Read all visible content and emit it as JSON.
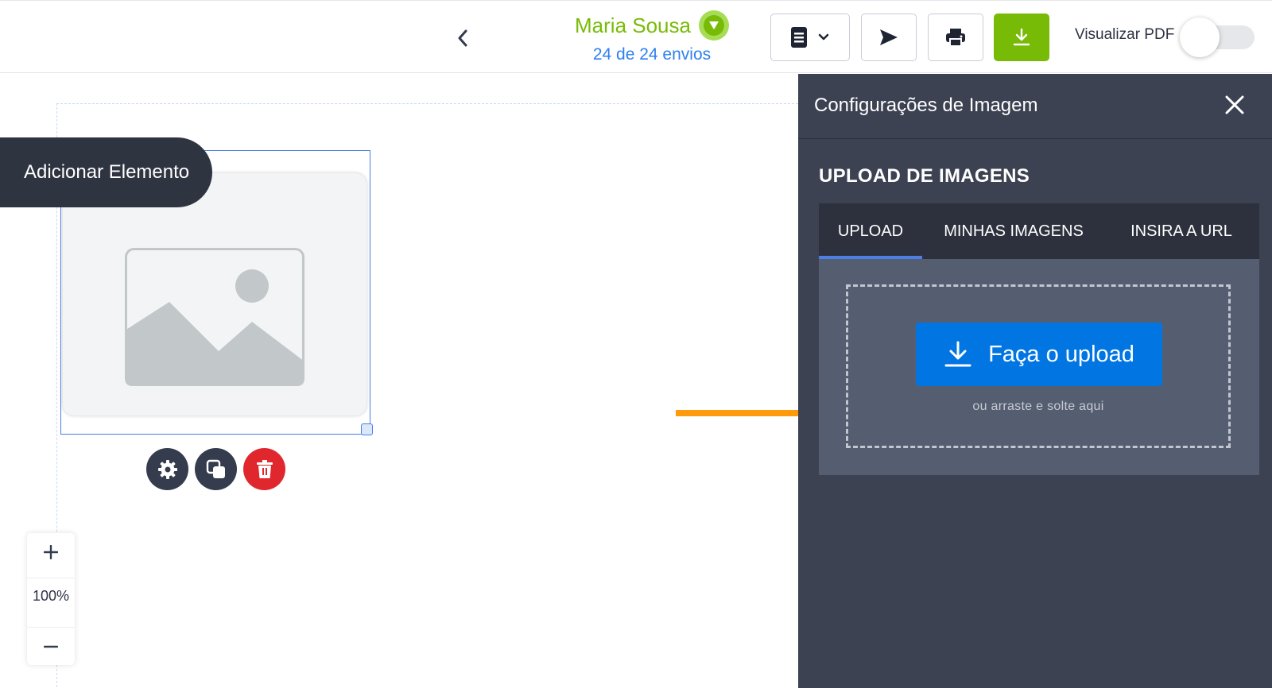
{
  "header": {
    "submitter_name": "Maria Sousa",
    "submission_count": "24 de 24 envios",
    "preview_pdf_label": "Visualizar PDF",
    "preview_pdf_enabled": false
  },
  "canvas": {
    "add_element_label": "Adicionar Elemento",
    "zoom_level": "100%",
    "zoom_in_symbol": "+",
    "zoom_out_symbol": "−"
  },
  "panel": {
    "title": "Configurações de Imagem",
    "section_title": "UPLOAD DE IMAGENS",
    "tabs": [
      {
        "label": "UPLOAD",
        "active": true
      },
      {
        "label": "MINHAS IMAGENS",
        "active": false
      },
      {
        "label": "INSIRA A URL",
        "active": false
      }
    ],
    "upload_button_label": "Faça o upload",
    "drop_hint": "ou arraste e solte aqui"
  },
  "colors": {
    "accent_green": "#78bb07",
    "link_blue": "#2f80ed",
    "upload_blue": "#0176e3",
    "panel_bg": "#3c4252",
    "delete_red": "#e0272e",
    "annotation_arrow": "#ff9a0a"
  },
  "icons": {
    "back": "chevron-left-icon",
    "submitter_dropdown": "caret-down-circle-icon",
    "layout": "document-list-icon",
    "send": "send-arrow-icon",
    "print": "printer-icon",
    "download": "download-icon",
    "close": "close-icon",
    "upload": "download-arrow-icon",
    "settings": "gear-icon",
    "duplicate": "copy-icon",
    "delete": "trash-icon",
    "placeholder": "image-placeholder-icon"
  }
}
